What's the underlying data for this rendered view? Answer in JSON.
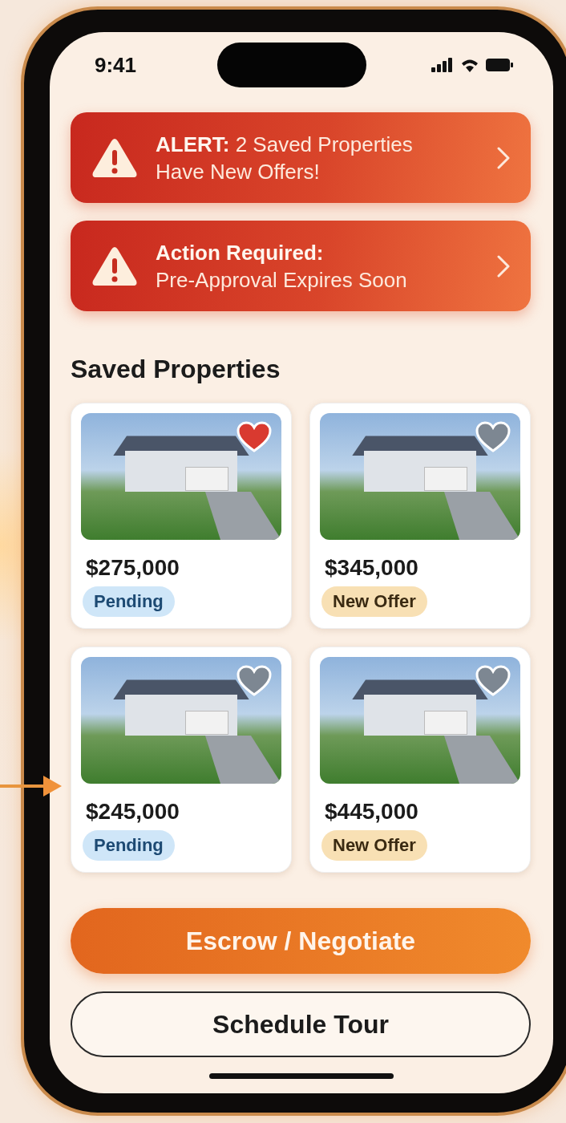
{
  "status_bar": {
    "time": "9:41"
  },
  "alerts": [
    {
      "text": "**ALERT:** 2 Saved Properties\nHave New Offers!"
    },
    {
      "text": "**Action Required:**\nPre-Approval Expires Soon"
    }
  ],
  "section_title": "Saved Properties",
  "properties": [
    {
      "price": "$275,000",
      "favorite": true,
      "badge": {
        "label": "Pending",
        "kind": "pending"
      }
    },
    {
      "price": "$345,000",
      "favorite": false,
      "badge": {
        "label": "New Offer",
        "kind": "new_offer"
      }
    },
    {
      "price": "$245,000",
      "favorite": false,
      "badge": {
        "label": "Pending",
        "kind": "pending"
      }
    },
    {
      "price": "$445,000",
      "favorite": false,
      "badge": {
        "label": "New Offer",
        "kind": "new_offer"
      }
    }
  ],
  "buttons": [
    {
      "label": "Escrow / Negotiate",
      "kind": "primary"
    },
    {
      "label": "Schedule Tour",
      "kind": "outline"
    }
  ]
}
